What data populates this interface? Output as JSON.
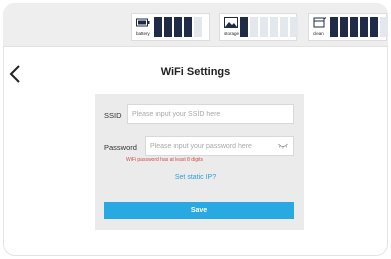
{
  "status_bar": {
    "battery": {
      "label": "battery",
      "icon": "battery-icon",
      "filled": 4,
      "total": 5
    },
    "storage": {
      "label": "storage",
      "icon": "storage-icon",
      "filled": 1,
      "total": 6
    },
    "clean": {
      "label": "clean",
      "icon": "clean-tank-icon",
      "filled": 5,
      "total": 6
    }
  },
  "header": {
    "back_icon": "chevron-left-icon",
    "title": "WiFi Settings"
  },
  "form": {
    "ssid_label": "SSID",
    "ssid_placeholder": "Please input your SSID here",
    "ssid_value": "",
    "password_label": "Password",
    "password_placeholder": "Please input your password here",
    "password_value": "",
    "password_hint": "WiFi password has at least 8 digits",
    "static_ip_link": "Set static IP?",
    "save_label": "Save"
  },
  "colors": {
    "accent": "#28a9e1",
    "error": "#d24b4b",
    "bar_filled": "#1f2b47",
    "bar_empty": "#e3e7ee",
    "panel": "#ebebeb"
  }
}
